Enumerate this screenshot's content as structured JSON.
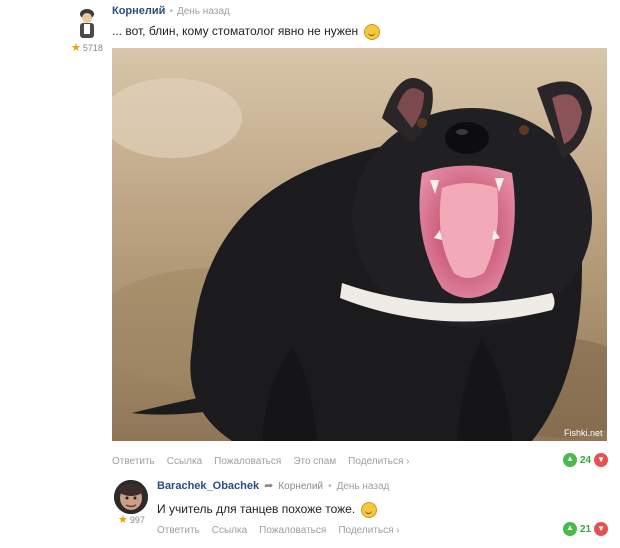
{
  "comment1": {
    "author": "Корнелий",
    "time": "День назад",
    "rating": "5718",
    "text": "... вот, блин, кому стоматолог явно не нужен",
    "image_watermark": "Fishki.net",
    "actions": [
      "Ответить",
      "Ссылка",
      "Пожаловаться",
      "Это спам",
      "Поделиться ›"
    ],
    "votes": "24"
  },
  "comment2": {
    "author": "Barachek_Obachek",
    "reply_to": "Корнелий",
    "time": "День назад",
    "rating": "997",
    "text": "И учитель для танцев похоже тоже.",
    "actions": [
      "Ответить",
      "Ссылка",
      "Пожаловаться",
      "Поделиться ›"
    ],
    "votes": "21"
  },
  "icons": {
    "star": "star-icon",
    "smiley": "smiley-icon",
    "reply_arrow": "reply-arrow-icon",
    "vote_up": "thumbs-up-icon",
    "vote_down": "thumbs-down-icon"
  },
  "colors": {
    "author": "#2d4e7a",
    "upvote": "#4cb94c",
    "downvote": "#e25252",
    "star": "#f0a000"
  }
}
